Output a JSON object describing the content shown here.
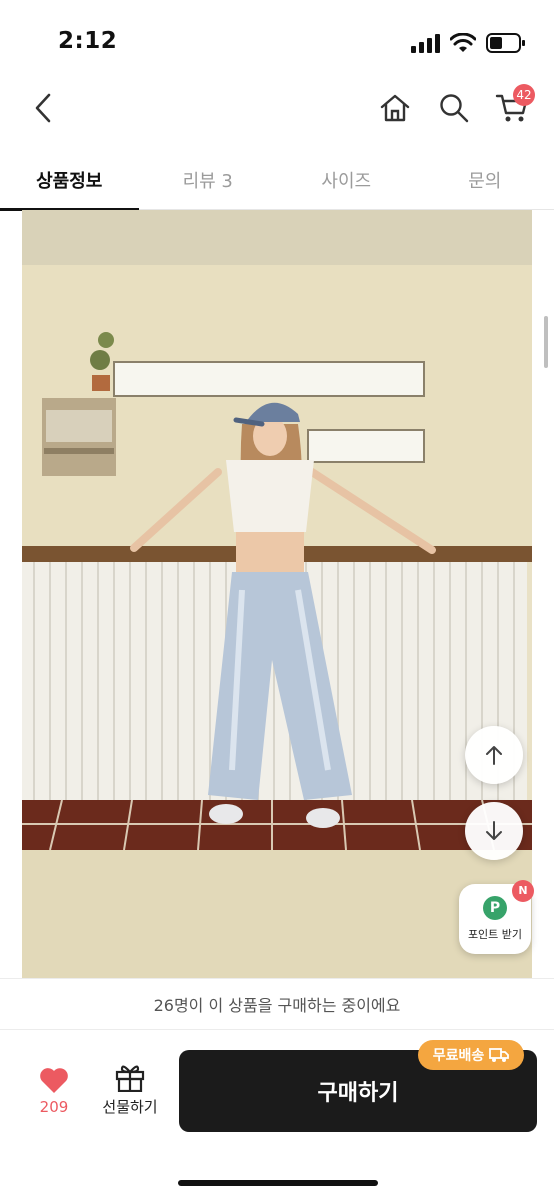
{
  "status_bar": {
    "time": "2:12"
  },
  "header": {
    "cart_count": "42"
  },
  "tabs": [
    {
      "label": "상품정보",
      "active": true
    },
    {
      "label": "리뷰 3",
      "active": false
    },
    {
      "label": "사이즈",
      "active": false
    },
    {
      "label": "문의",
      "active": false
    }
  ],
  "point_button": {
    "label": "포인트 받기",
    "icon_letter": "P",
    "badge": "N"
  },
  "notice": {
    "text": "26명이 이 상품을 구매하는 중이에요"
  },
  "bottom_bar": {
    "like_count": "209",
    "gift_label": "선물하기",
    "buy_label": "구매하기",
    "free_shipping_label": "무료배송"
  },
  "colors": {
    "accent_red": "#ec5a61",
    "buy_button": "#1b1b1b",
    "free_shipping": "#f4a640",
    "point_green": "#37a36a"
  }
}
